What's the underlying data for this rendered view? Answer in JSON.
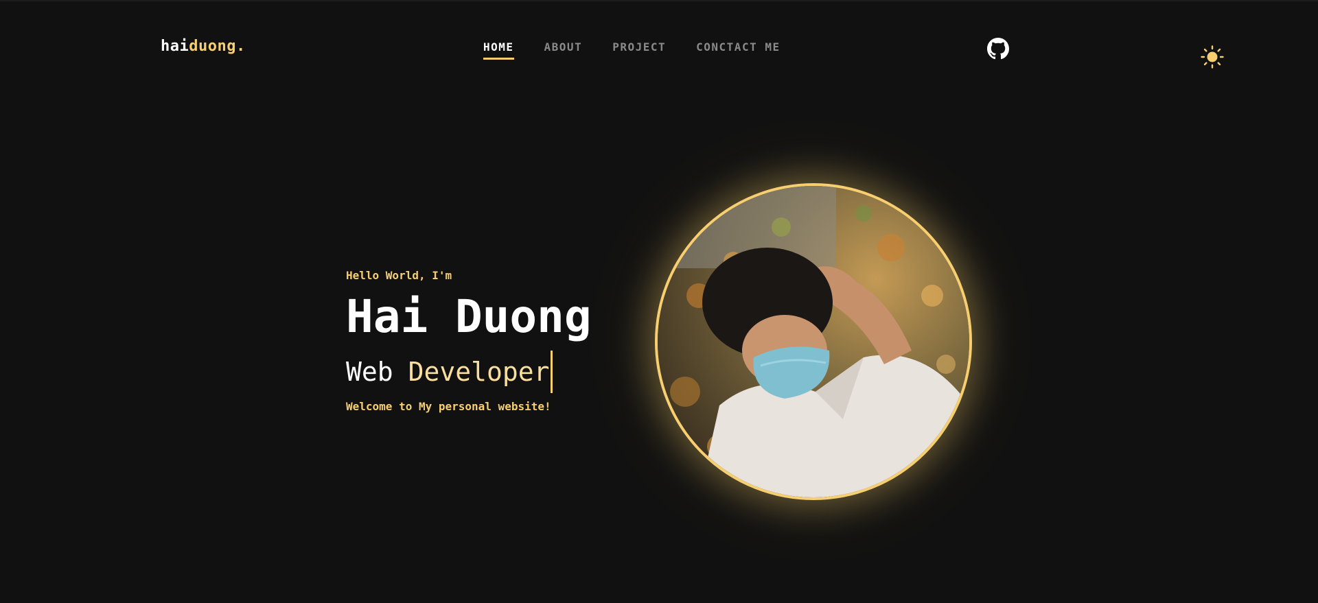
{
  "header": {
    "logo_primary": "hai",
    "logo_accent": "duong.",
    "nav": [
      {
        "label": "HOME",
        "active": true
      },
      {
        "label": "ABOUT",
        "active": false
      },
      {
        "label": "PROJECT",
        "active": false
      },
      {
        "label": "CONCTACT ME",
        "active": false
      }
    ],
    "github_icon": "github-icon",
    "theme_icon": "sun-icon"
  },
  "hero": {
    "greeting": "Hello World, I'm",
    "name": "Hai Duong",
    "role_prefix": "Web",
    "role_typed": "Developer",
    "welcome": "Welcome to My personal website!",
    "avatar_description": "avatar-photo"
  },
  "colors": {
    "background": "#111111",
    "accent": "#f7cf70",
    "accent_light": "#f9df9e",
    "nav_inactive": "#8a8a8a",
    "text": "#ffffff"
  }
}
